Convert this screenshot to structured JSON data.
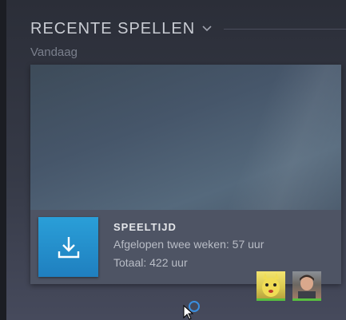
{
  "section": {
    "title": "RECENTE SPELLEN",
    "dropdown_icon": "chevron-down-icon",
    "day_label": "Vandaag"
  },
  "game_card": {
    "download_icon": "download-icon",
    "playtime_title": "SPEELTIJD",
    "playtime_recent": "Afgelopen twee weken: 57 uur",
    "playtime_total": "Totaal: 422 uur",
    "accent_color": "#1f8fcf",
    "friends": [
      {
        "avatar": "friend-avatar",
        "status_color": "#59bf40"
      },
      {
        "avatar": "friend-avatar",
        "status_color": "#59bf40"
      }
    ]
  }
}
